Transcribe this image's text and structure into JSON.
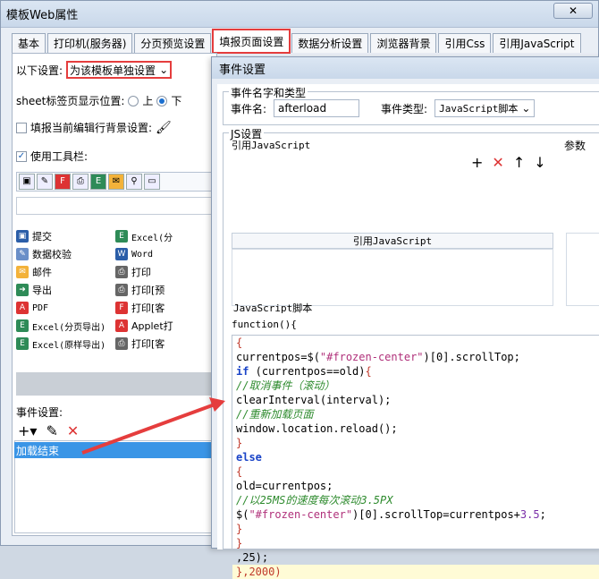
{
  "window": {
    "title": "模板Web属性",
    "close_label": "✕"
  },
  "tabs": [
    "基本",
    "打印机(服务器)",
    "分页预览设置",
    "填报页面设置",
    "数据分析设置",
    "浏览器背景",
    "引用Css",
    "引用JavaScript"
  ],
  "left": {
    "setting_label": "以下设置:",
    "setting_value": "为该模板单独设置",
    "sheet_label": "sheet标签页显示位置:",
    "radio_top": "上",
    "radio_bottom": "下",
    "bg_label": "填报当前编辑行背景设置:",
    "toolbar_label": "使用工具栏:",
    "buttons": [
      [
        "提交",
        "Excel(分"
      ],
      [
        "数据校验",
        "Word"
      ],
      [
        "邮件",
        "打印"
      ],
      [
        "导出",
        "打印[预"
      ],
      [
        "PDF",
        "打印[客"
      ],
      [
        "Excel(分页导出)",
        "Applet打"
      ],
      [
        "Excel(原样导出)",
        "打印[客"
      ]
    ],
    "event_label": "事件设置:",
    "event_item": "加载结束"
  },
  "dialog": {
    "title": "事件设置",
    "group_name_type": "事件名字和类型",
    "event_name_label": "事件名:",
    "event_name_value": "afterload",
    "event_type_label": "事件类型:",
    "event_type_value": "JavaScript脚本",
    "js_settings": "JS设置",
    "ref_js_label": "引用JavaScript",
    "param_label": "参数",
    "ref_js_header": "引用JavaScript",
    "script_label": "JavaScript脚本",
    "fn_header": "function(){"
  },
  "code_lines": [
    "{",
    "currentpos=$(\"#frozen-center\")[0].scrollTop;",
    "if (currentpos==old){",
    "//取消事件（滚动）",
    "clearInterval(interval);",
    "//重新加载页面",
    "window.location.reload();",
    "}",
    "else",
    "{",
    "old=currentpos;",
    "//以25MS的速度每次滚动3.5PX",
    "$(\"#frozen-center\")[0].scrollTop=currentpos+3.5;",
    "}",
    "}",
    ",25);",
    "},2000)"
  ],
  "colors": {
    "highlight": "#e53d3d",
    "selection": "#3a95e6"
  }
}
